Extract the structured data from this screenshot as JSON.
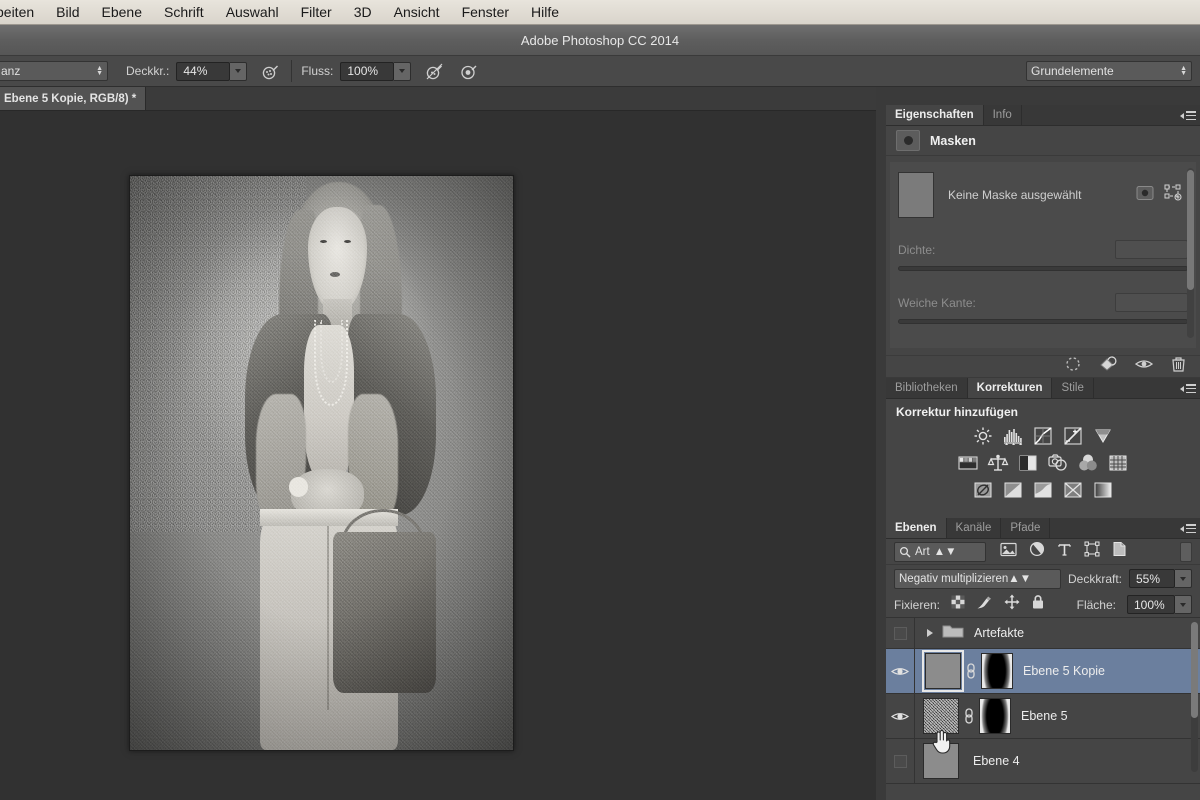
{
  "app": {
    "title": "Adobe Photoshop CC 2014"
  },
  "menubar": {
    "items": [
      {
        "label": "beiten",
        "name": "menu-bearbeiten"
      },
      {
        "label": "Bild",
        "name": "menu-bild"
      },
      {
        "label": "Ebene",
        "name": "menu-ebene"
      },
      {
        "label": "Schrift",
        "name": "menu-schrift"
      },
      {
        "label": "Auswahl",
        "name": "menu-auswahl"
      },
      {
        "label": "Filter",
        "name": "menu-filter"
      },
      {
        "label": "3D",
        "name": "menu-3d"
      },
      {
        "label": "Ansicht",
        "name": "menu-ansicht"
      },
      {
        "label": "Fenster",
        "name": "menu-fenster"
      },
      {
        "label": "Hilfe",
        "name": "menu-hilfe"
      }
    ]
  },
  "options_bar": {
    "blend_mode_value": "anz",
    "opacity_label": "Deckkr.:",
    "opacity_value": "44%",
    "flow_label": "Fluss:",
    "flow_value": "100%",
    "airbrush_icon": "airbrush-icon",
    "pressure_opacity_icon": "pressure-opacity-icon",
    "pressure_size_icon": "pressure-size-icon",
    "workspace_value": "Grundelemente"
  },
  "document_tab": {
    "label": "Ebene 5 Kopie, RGB/8) *"
  },
  "properties_panel": {
    "tabs": [
      {
        "label": "Eigenschaften",
        "active": true
      },
      {
        "label": "Info",
        "active": false
      }
    ],
    "header": "Masken",
    "mask_status": "Keine Maske ausgewählt",
    "density_label": "Dichte:",
    "density_value": "",
    "feather_label": "Weiche Kante:",
    "feather_value": "",
    "footer_icons": [
      "selection-from-mask-icon",
      "apply-mask-icon",
      "toggle-mask-icon",
      "delete-mask-icon"
    ],
    "mask_row_icons": [
      "pixel-mask-icon",
      "vector-mask-icon"
    ]
  },
  "adjustments_panel": {
    "tabs": [
      {
        "label": "Bibliotheken",
        "active": false
      },
      {
        "label": "Korrekturen",
        "active": true
      },
      {
        "label": "Stile",
        "active": false
      }
    ],
    "title": "Korrektur hinzufügen",
    "rows": [
      [
        "brightness-contrast-icon",
        "levels-icon",
        "curves-icon",
        "exposure-icon",
        "vibrance-icon"
      ],
      [
        "hue-saturation-icon",
        "color-balance-icon",
        "black-white-icon",
        "photo-filter-icon",
        "channel-mixer-icon",
        "color-lookup-icon"
      ],
      [
        "invert-icon",
        "posterize-icon",
        "threshold-icon",
        "selective-color-icon",
        "gradient-map-icon"
      ]
    ]
  },
  "layers_panel": {
    "tabs": [
      {
        "label": "Ebenen",
        "active": true
      },
      {
        "label": "Kanäle",
        "active": false
      },
      {
        "label": "Pfade",
        "active": false
      }
    ],
    "filter_value": "Art",
    "filter_icons": [
      "filter-pixel-icon",
      "filter-adjustment-icon",
      "filter-type-icon",
      "filter-shape-icon",
      "filter-smartobject-icon"
    ],
    "blend_mode": "Negativ multiplizieren",
    "opacity_label": "Deckkraft:",
    "opacity_value": "55%",
    "lock_label": "Fixieren:",
    "lock_icons": [
      "lock-transparency-icon",
      "lock-image-icon",
      "lock-position-icon",
      "lock-all-icon"
    ],
    "fill_label": "Fläche:",
    "fill_value": "100%",
    "rows": [
      {
        "name": "Artefakte",
        "type": "group",
        "visible": false,
        "selected": false
      },
      {
        "name": "Ebene 5 Kopie",
        "type": "layer",
        "visible": true,
        "selected": true,
        "has_mask": true,
        "linked": true,
        "thumb": "solid"
      },
      {
        "name": "Ebene 5",
        "type": "layer",
        "visible": true,
        "selected": false,
        "has_mask": true,
        "linked": true,
        "thumb": "noise"
      },
      {
        "name": "Ebene 4",
        "type": "layer",
        "visible": false,
        "selected": false,
        "has_mask": false,
        "linked": false,
        "thumb": "solid"
      }
    ]
  },
  "colors": {
    "menubar_bg": "#e0dcd3",
    "titlebar_bg": "#5e5e5e",
    "panel_bg": "#454545",
    "canvas_bg": "#313131",
    "selection_blue": "#6b7f9e",
    "text_light": "#ededed"
  }
}
